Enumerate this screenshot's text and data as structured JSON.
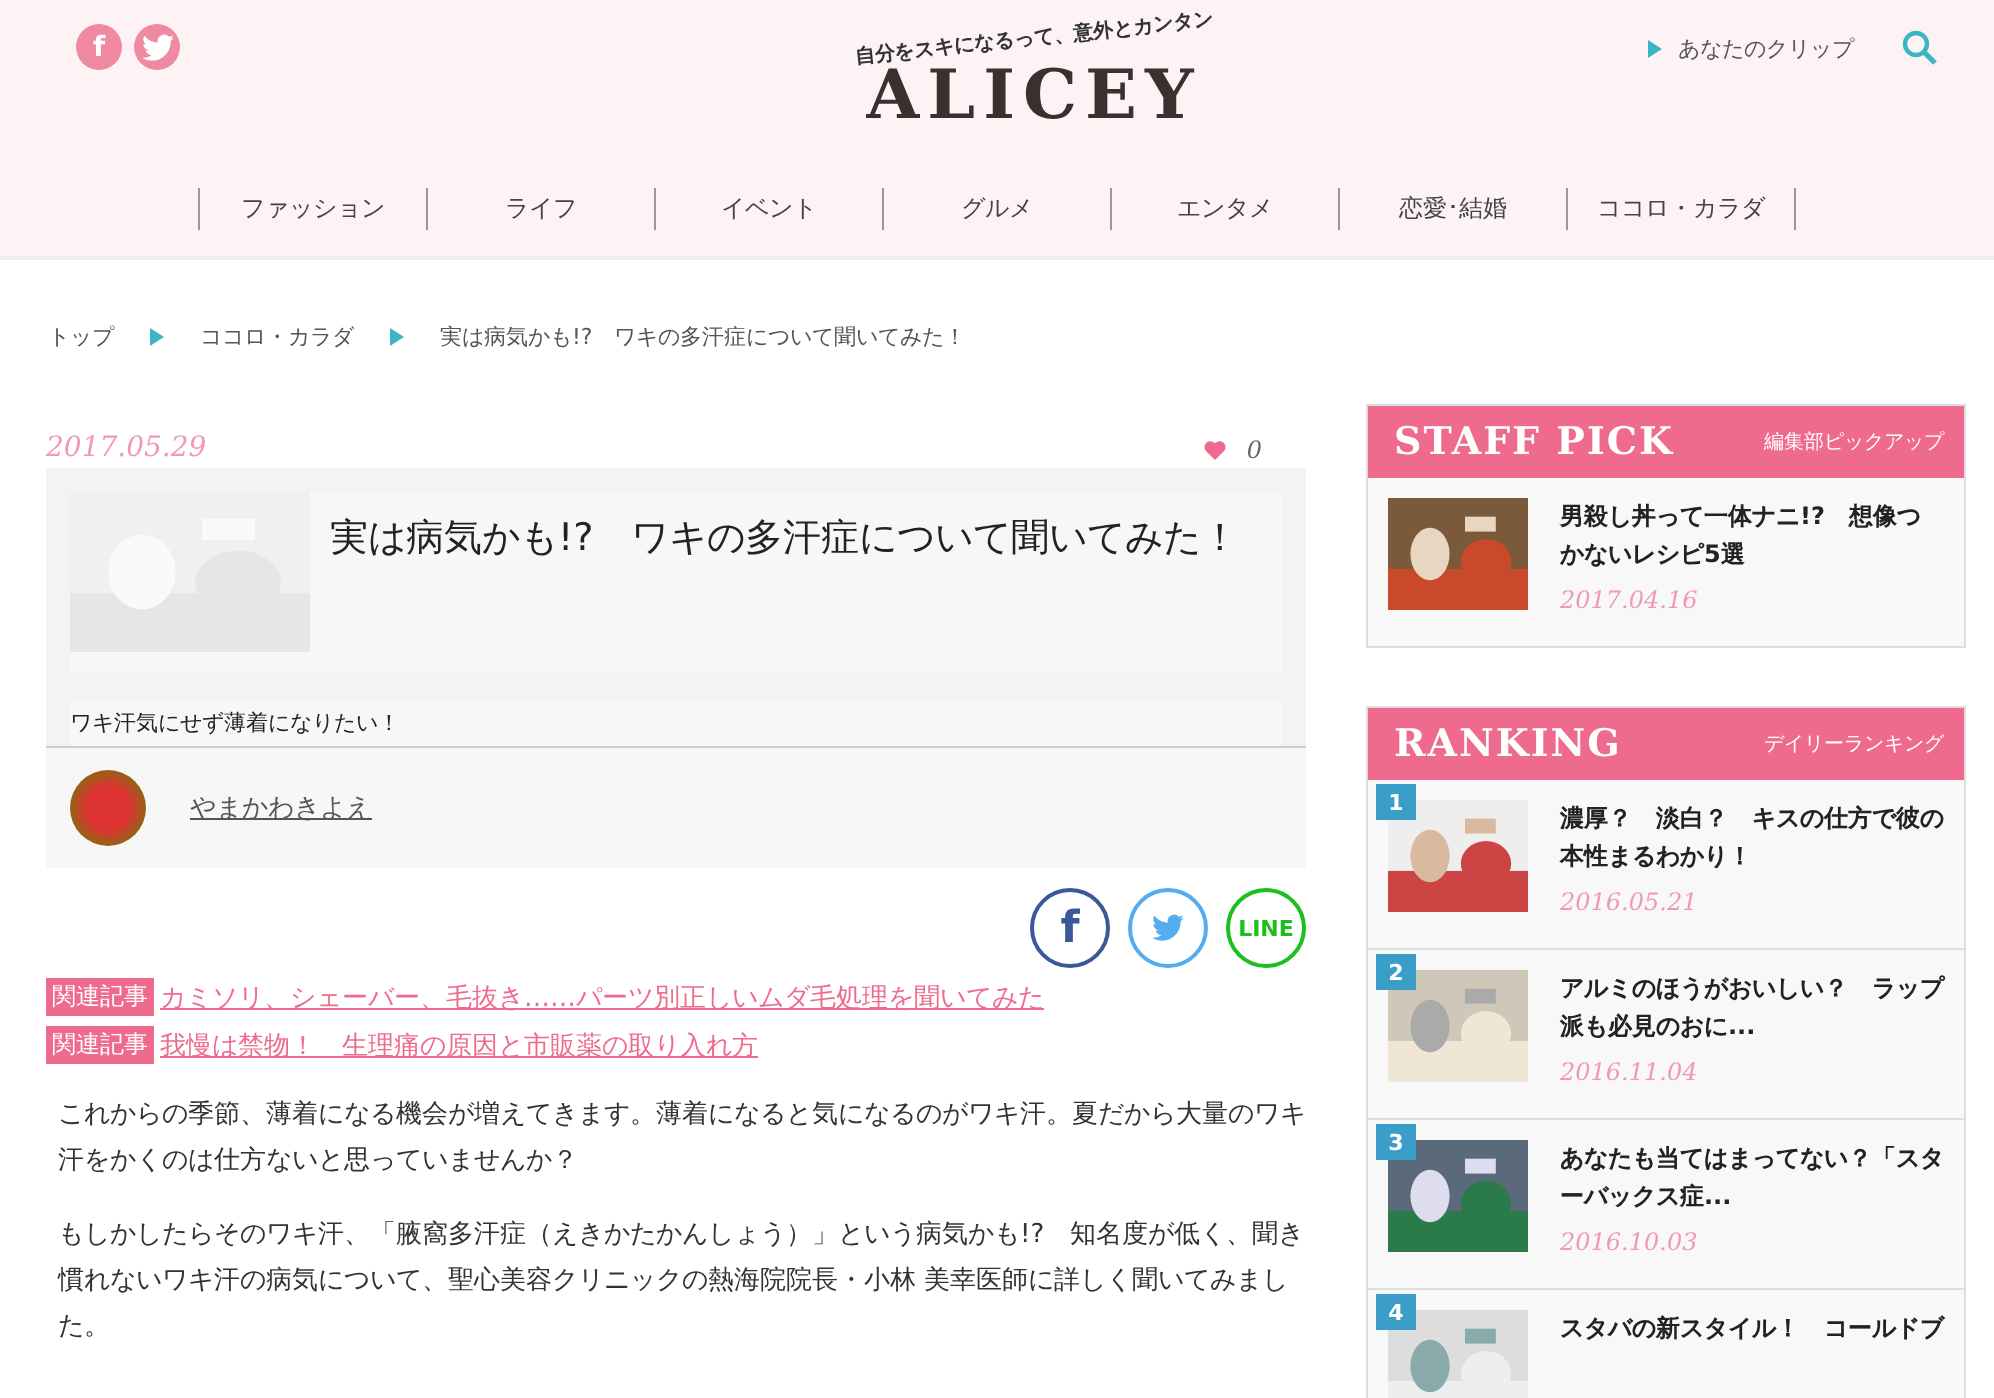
{
  "header": {
    "social": [
      {
        "kind": "facebook",
        "glyph": "f"
      },
      {
        "kind": "twitter"
      }
    ],
    "tagline": "自分をスキになるって、意外とカンタン",
    "logo": "ALICEY",
    "clip_link": "あなたのクリップ"
  },
  "nav": [
    "ファッション",
    "ライフ",
    "イベント",
    "グルメ",
    "エンタメ",
    "恋愛･結婚",
    "ココロ・カラダ"
  ],
  "breadcrumb": [
    "トップ",
    "ココロ・カラダ",
    "実は病気かも!?　ワキの多汗症について聞いてみた！"
  ],
  "article": {
    "date": "2017.05.29",
    "likes": "0",
    "title": "実は病気かも!?　ワキの多汗症について聞いてみた！",
    "lead": "ワキ汗気にせず薄着になりたい！",
    "author": "やまかわきよえ",
    "share": [
      {
        "kind": "facebook",
        "glyph": "f"
      },
      {
        "kind": "twitter"
      },
      {
        "kind": "line",
        "glyph": "LINE"
      }
    ],
    "related": [
      {
        "tag": "関連記事",
        "title": "カミソリ、シェーバー、毛抜き……パーツ別正しいムダ毛処理を聞いてみた"
      },
      {
        "tag": "関連記事",
        "title": "我慢は禁物！　生理痛の原因と市販薬の取り入れ方"
      }
    ],
    "paragraphs": [
      "これからの季節、薄着になる機会が増えてきます。薄着になると気になるのがワキ汗。夏だから大量のワキ汗をかくのは仕方ないと思っていませんか？",
      "もしかしたらそのワキ汗、「腋窩多汗症（えきかたかんしょう）」という病気かも!?　知名度が低く、聞き慣れないワキ汗の病気について、聖心美容クリニックの熱海院院長・小林 美幸医師に詳しく聞いてみました。"
    ]
  },
  "staff_pick": {
    "title": "STAFF PICK",
    "subtitle": "編集部ピックアップ",
    "items": [
      {
        "title": "男殺し丼って一体ナニ!?　想像つかないレシピ5選",
        "date": "2017.04.16"
      }
    ]
  },
  "ranking": {
    "title": "RANKING",
    "subtitle": "デイリーランキング",
    "items": [
      {
        "rank": "1",
        "title": "濃厚？　淡白？　キスの仕方で彼の本性まるわかり！",
        "date": "2016.05.21"
      },
      {
        "rank": "2",
        "title": "アルミのほうがおいしい？　ラップ派も必見のおに...",
        "date": "2016.11.04"
      },
      {
        "rank": "3",
        "title": "あなたも当てはまってない？「スターバックス症...",
        "date": "2016.10.03"
      },
      {
        "rank": "4",
        "title": "スタバの新スタイル！　コールドブ"
      }
    ]
  }
}
